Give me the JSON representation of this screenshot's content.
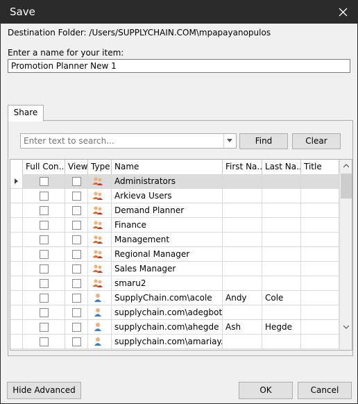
{
  "window": {
    "title": "Save"
  },
  "destination": "Destination Folder: /Users/SUPPLYCHAIN.COM\\mpapayanopulos",
  "name_label": "Enter a name for your item:",
  "name_value": "Promotion Planner New 1",
  "tab": "Share",
  "search": {
    "placeholder": "Enter text to search...",
    "find_label": "Find",
    "clear_label": "Clear"
  },
  "columns": [
    "Full Con...",
    "View",
    "Type",
    "Name",
    "First Na...",
    "Last Na...",
    "Title"
  ],
  "rows": [
    {
      "name": "Administrators",
      "first": "",
      "last": "",
      "type": "group-icon"
    },
    {
      "name": "Arkieva Users",
      "first": "",
      "last": "",
      "type": "group-icon"
    },
    {
      "name": "Demand Planner",
      "first": "",
      "last": "",
      "type": "group-icon"
    },
    {
      "name": "Finance",
      "first": "",
      "last": "",
      "type": "group-icon"
    },
    {
      "name": "Management",
      "first": "",
      "last": "",
      "type": "group-icon"
    },
    {
      "name": "Regional Manager",
      "first": "",
      "last": "",
      "type": "group-icon"
    },
    {
      "name": "Sales Manager",
      "first": "",
      "last": "",
      "type": "group-icon"
    },
    {
      "name": "smaru2",
      "first": "",
      "last": "",
      "type": "group-icon"
    },
    {
      "name": "SupplyChain.com\\acole",
      "first": "Andy",
      "last": "Cole",
      "type": "user-icon"
    },
    {
      "name": "supplychain.com\\adegbotse",
      "first": "",
      "last": "",
      "type": "user-icon"
    },
    {
      "name": "supplychain.com\\ahegde",
      "first": "Ash",
      "last": "Hegde",
      "type": "user-icon"
    },
    {
      "name": "supplychain.com\\amariay...",
      "first": "",
      "last": "",
      "type": "user-icon"
    }
  ],
  "buttons": {
    "hide_advanced": "Hide Advanced",
    "ok": "OK",
    "cancel": "Cancel"
  },
  "colors": {
    "titlebar": "#2b2b2b",
    "selected_row": "#dcdcdc",
    "group_icon": "#e06a2c",
    "user_icon": "#3a7dc9"
  }
}
